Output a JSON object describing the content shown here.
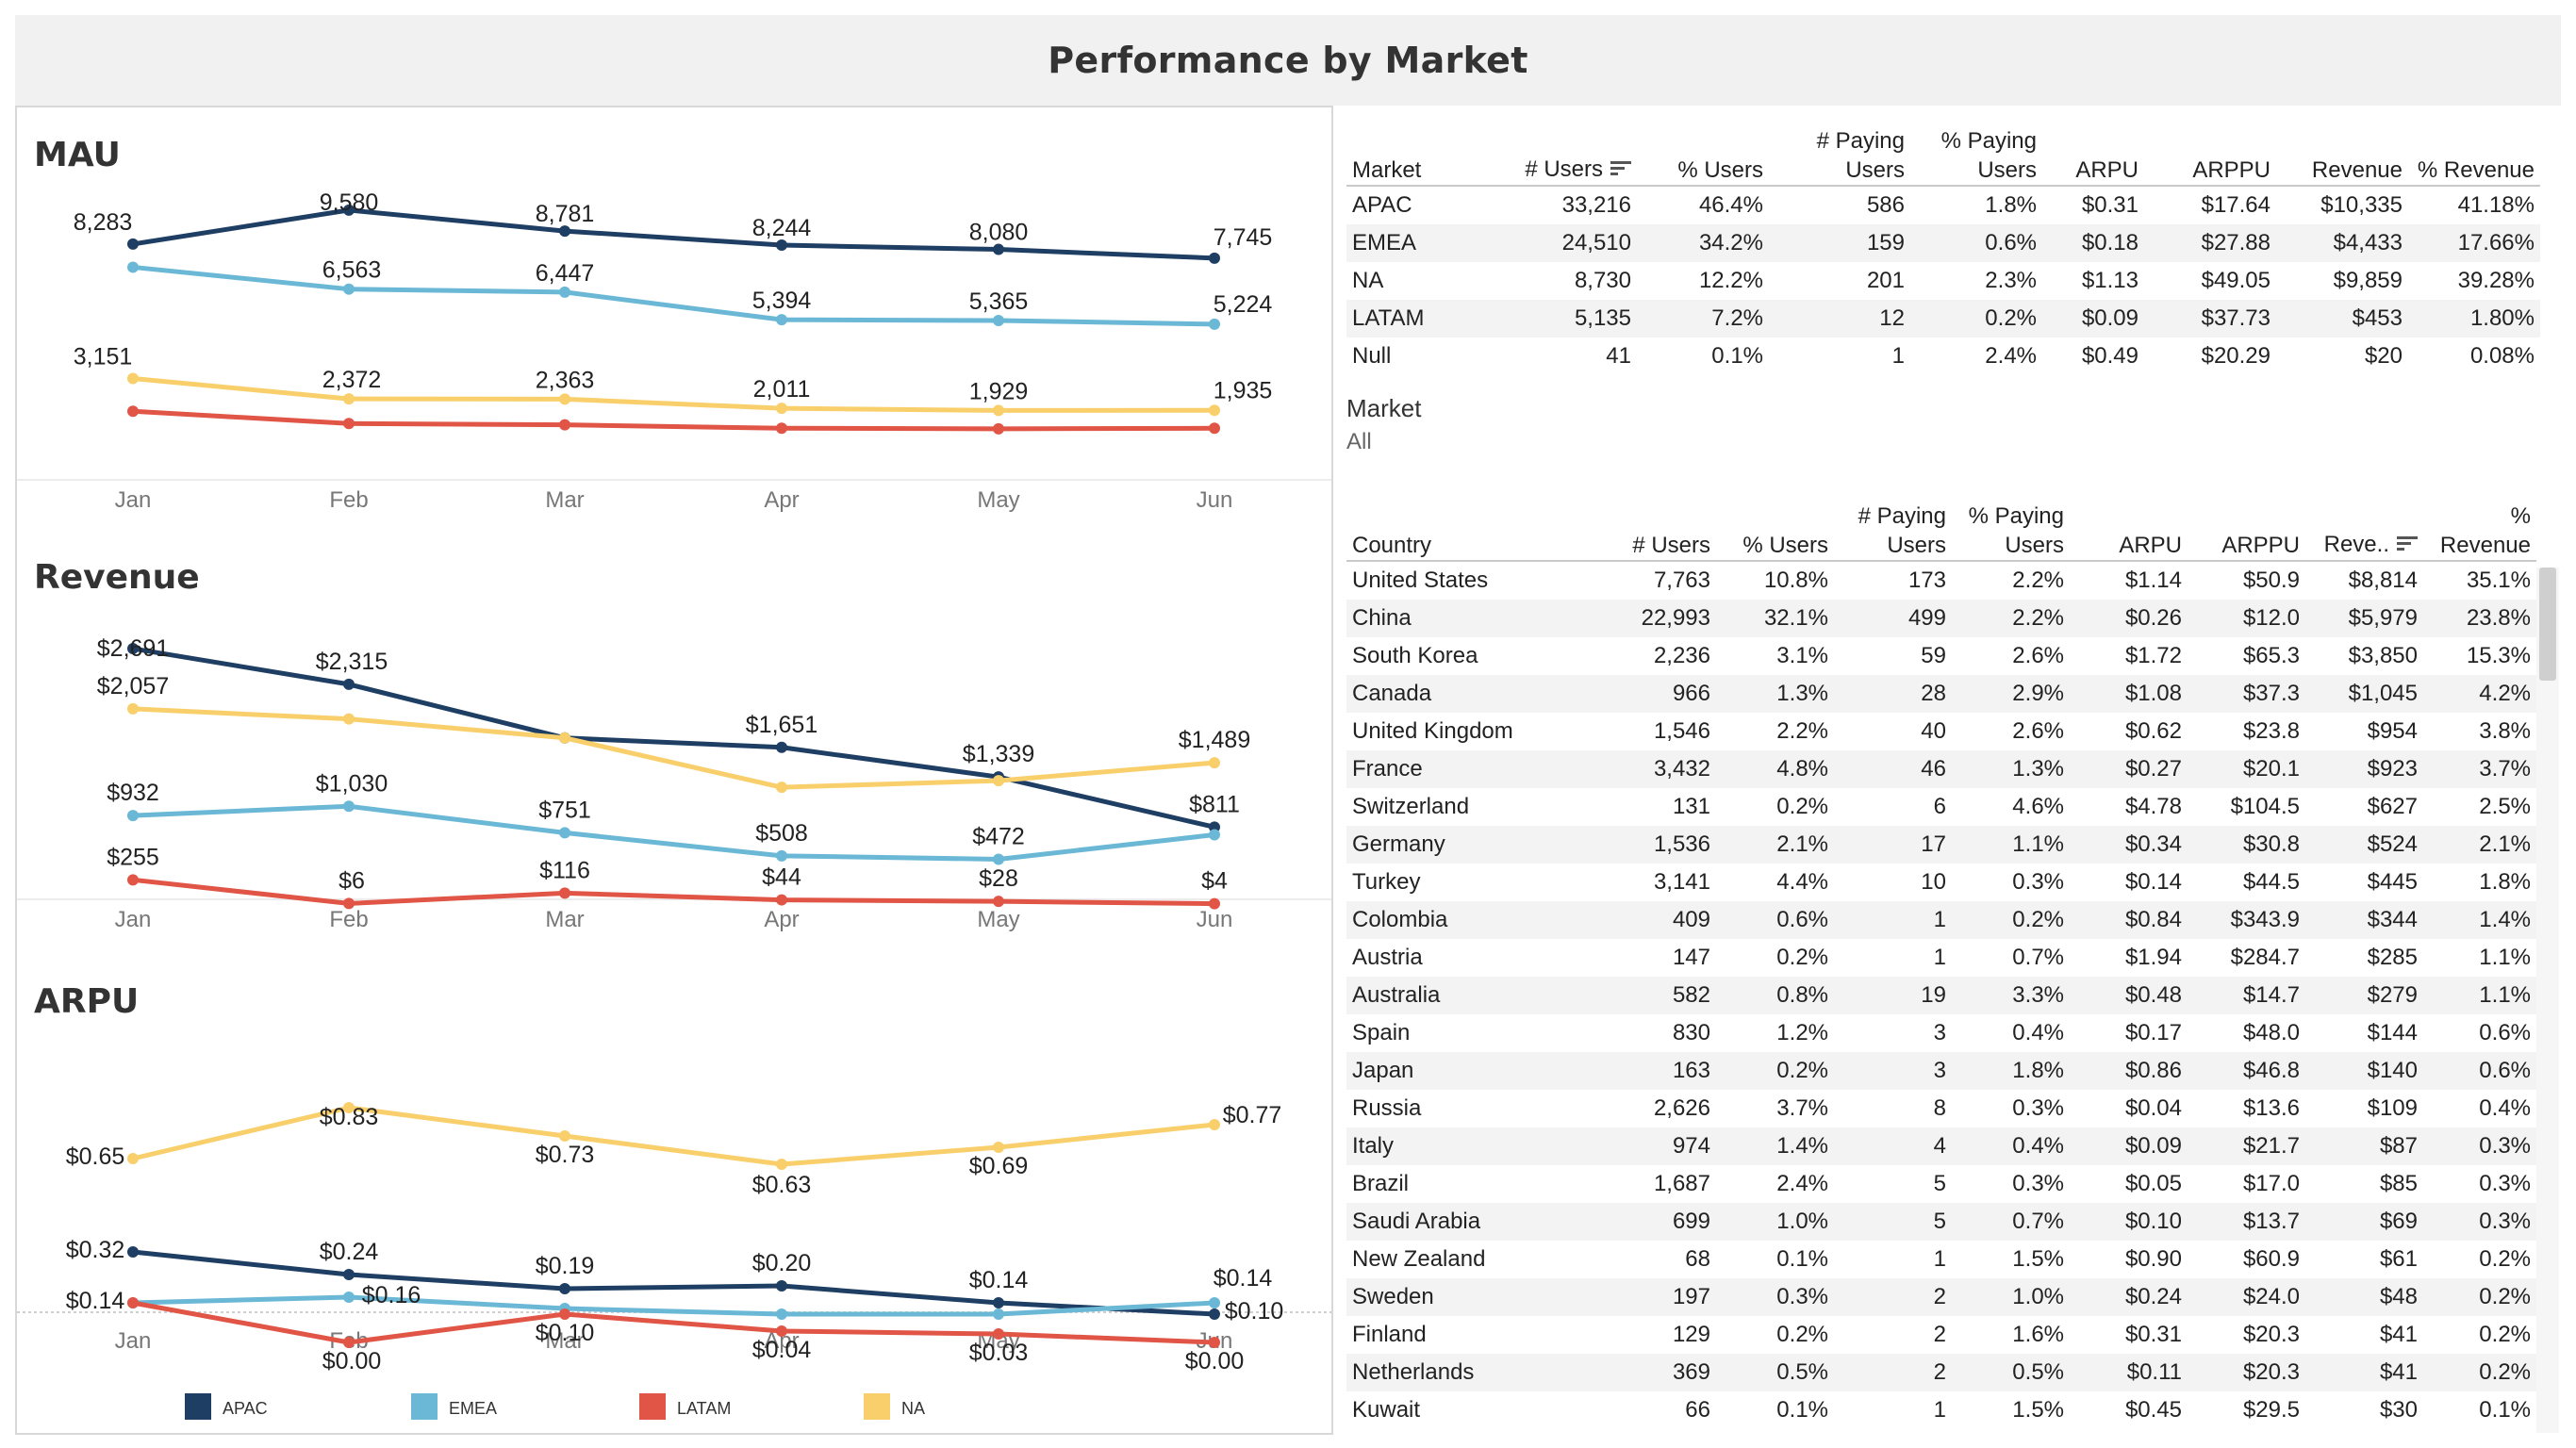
{
  "page_title": "Performance by Market",
  "colors": {
    "APAC": "#1f3e63",
    "EMEA": "#6ab8d6",
    "LATAM": "#e05546",
    "NA": "#f9cf6b"
  },
  "legend": [
    "APAC",
    "EMEA",
    "LATAM",
    "NA"
  ],
  "chart_data": [
    {
      "type": "line",
      "title": "MAU",
      "categories": [
        "Jan",
        "Feb",
        "Mar",
        "Apr",
        "May",
        "Jun"
      ],
      "series": [
        {
          "name": "APAC",
          "values": [
            8283,
            9580,
            8781,
            8244,
            8080,
            7745
          ],
          "labels": [
            "8,283",
            "9,580",
            "8,781",
            "8,244",
            "8,080",
            "7,745"
          ]
        },
        {
          "name": "EMEA",
          "values": [
            7400,
            6563,
            6447,
            5394,
            5365,
            5224
          ],
          "labels": [
            "",
            "6,563",
            "6,447",
            "5,394",
            "5,365",
            "5,224"
          ]
        },
        {
          "name": "NA",
          "values": [
            3151,
            2372,
            2363,
            2011,
            1929,
            1935
          ],
          "labels": [
            "3,151",
            "2,372",
            "2,363",
            "2,011",
            "1,929",
            "1,935"
          ]
        },
        {
          "name": "LATAM",
          "values": [
            1900,
            1430,
            1380,
            1250,
            1230,
            1250
          ],
          "labels": [
            "",
            "",
            "",
            "",
            "",
            ""
          ]
        }
      ]
    },
    {
      "type": "line",
      "title": "Revenue",
      "categories": [
        "Jan",
        "Feb",
        "Mar",
        "Apr",
        "May",
        "Jun"
      ],
      "series": [
        {
          "name": "APAC",
          "values": [
            2691,
            2315,
            1750,
            1651,
            1339,
            811
          ],
          "labels": [
            "$2,691",
            "$2,315",
            "",
            "$1,651",
            "$1,339",
            "$811"
          ]
        },
        {
          "name": "NA",
          "values": [
            2057,
            1950,
            1750,
            1230,
            1300,
            1489
          ],
          "labels": [
            "$2,057",
            "",
            "",
            "",
            "",
            "$1,489"
          ]
        },
        {
          "name": "EMEA",
          "values": [
            932,
            1030,
            751,
            508,
            472,
            730
          ],
          "labels": [
            "$932",
            "$1,030",
            "$751",
            "$508",
            "$472",
            ""
          ]
        },
        {
          "name": "LATAM",
          "values": [
            255,
            6,
            116,
            44,
            28,
            4
          ],
          "labels": [
            "$255",
            "$6",
            "$116",
            "$44",
            "$28",
            "$4"
          ]
        }
      ]
    },
    {
      "type": "line",
      "title": "ARPU",
      "categories": [
        "Jan",
        "Feb",
        "Mar",
        "Apr",
        "May",
        "Jun"
      ],
      "series": [
        {
          "name": "NA",
          "values": [
            0.65,
            0.83,
            0.73,
            0.63,
            0.69,
            0.77
          ],
          "labels": [
            "$0.65",
            "$0.83",
            "$0.73",
            "$0.63",
            "$0.69",
            "$0.77"
          ]
        },
        {
          "name": "APAC",
          "values": [
            0.32,
            0.24,
            0.19,
            0.2,
            0.14,
            0.1
          ],
          "labels": [
            "$0.32",
            "$0.24",
            "$0.19",
            "$0.20",
            "$0.14",
            "$0.10"
          ]
        },
        {
          "name": "EMEA",
          "values": [
            0.14,
            0.16,
            0.12,
            0.1,
            0.1,
            0.14
          ],
          "labels": [
            "",
            "$0.16",
            "",
            "",
            "",
            "$0.14"
          ]
        },
        {
          "name": "LATAM",
          "values": [
            0.14,
            0.0,
            0.1,
            0.04,
            0.03,
            0.0
          ],
          "labels": [
            "$0.14",
            "$0.00",
            "$0.10",
            "$0.04",
            "$0.03",
            "$0.00"
          ]
        }
      ]
    }
  ],
  "market_table": {
    "headers": [
      "Market",
      "# Users",
      "% Users",
      "# Paying Users",
      "% Paying Users",
      "ARPU",
      "ARPPU",
      "Revenue",
      "% Revenue"
    ],
    "rows": [
      [
        "APAC",
        "33,216",
        "46.4%",
        "586",
        "1.8%",
        "$0.31",
        "$17.64",
        "$10,335",
        "41.18%"
      ],
      [
        "EMEA",
        "24,510",
        "34.2%",
        "159",
        "0.6%",
        "$0.18",
        "$27.88",
        "$4,433",
        "17.66%"
      ],
      [
        "NA",
        "8,730",
        "12.2%",
        "201",
        "2.3%",
        "$1.13",
        "$49.05",
        "$9,859",
        "39.28%"
      ],
      [
        "LATAM",
        "5,135",
        "7.2%",
        "12",
        "0.2%",
        "$0.09",
        "$37.73",
        "$453",
        "1.80%"
      ],
      [
        "Null",
        "41",
        "0.1%",
        "1",
        "2.4%",
        "$0.49",
        "$20.29",
        "$20",
        "0.08%"
      ]
    ]
  },
  "market_filter": {
    "label": "Market",
    "value": "All"
  },
  "country_table": {
    "headers": [
      "Country",
      "# Users",
      "% Users",
      "# Paying Users",
      "% Paying Users",
      "ARPU",
      "ARPPU",
      "Reve..",
      "% Revenue"
    ],
    "rows": [
      [
        "United States",
        "7,763",
        "10.8%",
        "173",
        "2.2%",
        "$1.14",
        "$50.9",
        "$8,814",
        "35.1%"
      ],
      [
        "China",
        "22,993",
        "32.1%",
        "499",
        "2.2%",
        "$0.26",
        "$12.0",
        "$5,979",
        "23.8%"
      ],
      [
        "South Korea",
        "2,236",
        "3.1%",
        "59",
        "2.6%",
        "$1.72",
        "$65.3",
        "$3,850",
        "15.3%"
      ],
      [
        "Canada",
        "966",
        "1.3%",
        "28",
        "2.9%",
        "$1.08",
        "$37.3",
        "$1,045",
        "4.2%"
      ],
      [
        "United Kingdom",
        "1,546",
        "2.2%",
        "40",
        "2.6%",
        "$0.62",
        "$23.8",
        "$954",
        "3.8%"
      ],
      [
        "France",
        "3,432",
        "4.8%",
        "46",
        "1.3%",
        "$0.27",
        "$20.1",
        "$923",
        "3.7%"
      ],
      [
        "Switzerland",
        "131",
        "0.2%",
        "6",
        "4.6%",
        "$4.78",
        "$104.5",
        "$627",
        "2.5%"
      ],
      [
        "Germany",
        "1,536",
        "2.1%",
        "17",
        "1.1%",
        "$0.34",
        "$30.8",
        "$524",
        "2.1%"
      ],
      [
        "Turkey",
        "3,141",
        "4.4%",
        "10",
        "0.3%",
        "$0.14",
        "$44.5",
        "$445",
        "1.8%"
      ],
      [
        "Colombia",
        "409",
        "0.6%",
        "1",
        "0.2%",
        "$0.84",
        "$343.9",
        "$344",
        "1.4%"
      ],
      [
        "Austria",
        "147",
        "0.2%",
        "1",
        "0.7%",
        "$1.94",
        "$284.7",
        "$285",
        "1.1%"
      ],
      [
        "Australia",
        "582",
        "0.8%",
        "19",
        "3.3%",
        "$0.48",
        "$14.7",
        "$279",
        "1.1%"
      ],
      [
        "Spain",
        "830",
        "1.2%",
        "3",
        "0.4%",
        "$0.17",
        "$48.0",
        "$144",
        "0.6%"
      ],
      [
        "Japan",
        "163",
        "0.2%",
        "3",
        "1.8%",
        "$0.86",
        "$46.8",
        "$140",
        "0.6%"
      ],
      [
        "Russia",
        "2,626",
        "3.7%",
        "8",
        "0.3%",
        "$0.04",
        "$13.6",
        "$109",
        "0.4%"
      ],
      [
        "Italy",
        "974",
        "1.4%",
        "4",
        "0.4%",
        "$0.09",
        "$21.7",
        "$87",
        "0.3%"
      ],
      [
        "Brazil",
        "1,687",
        "2.4%",
        "5",
        "0.3%",
        "$0.05",
        "$17.0",
        "$85",
        "0.3%"
      ],
      [
        "Saudi Arabia",
        "699",
        "1.0%",
        "5",
        "0.7%",
        "$0.10",
        "$13.7",
        "$69",
        "0.3%"
      ],
      [
        "New Zealand",
        "68",
        "0.1%",
        "1",
        "1.5%",
        "$0.90",
        "$60.9",
        "$61",
        "0.2%"
      ],
      [
        "Sweden",
        "197",
        "0.3%",
        "2",
        "1.0%",
        "$0.24",
        "$24.0",
        "$48",
        "0.2%"
      ],
      [
        "Finland",
        "129",
        "0.2%",
        "2",
        "1.6%",
        "$0.31",
        "$20.3",
        "$41",
        "0.2%"
      ],
      [
        "Netherlands",
        "369",
        "0.5%",
        "2",
        "0.5%",
        "$0.11",
        "$20.3",
        "$41",
        "0.2%"
      ],
      [
        "Kuwait",
        "66",
        "0.1%",
        "1",
        "1.5%",
        "$0.45",
        "$29.5",
        "$30",
        "0.1%"
      ]
    ]
  }
}
